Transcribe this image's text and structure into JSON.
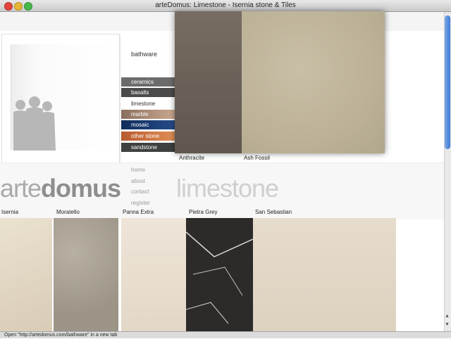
{
  "window": {
    "title": "arteDomus: Limestone - Isernia stone & Tiles"
  },
  "header": {
    "bathware_link": "bathware"
  },
  "menu": {
    "items": [
      {
        "label": "ceramics",
        "color": "#6b6b6b"
      },
      {
        "label": "basalts",
        "color": "#4b4b4b"
      },
      {
        "label": "limestone",
        "color": "#ffffff"
      },
      {
        "label": "marble",
        "color": "#b99a85"
      },
      {
        "label": "mosaic",
        "color": "#1b3b6e"
      },
      {
        "label": "other stone",
        "color": "#d07a45"
      },
      {
        "label": "sandstone",
        "color": "#3f4040"
      }
    ]
  },
  "nav": {
    "home": "home",
    "about": "about",
    "contact": "contact",
    "register": "register"
  },
  "branding": {
    "logo_light": "arte",
    "logo_bold": "domus",
    "page_heading": "limestone"
  },
  "popup": {
    "items": [
      {
        "label": "Anthracite",
        "color": "#6a6158"
      },
      {
        "label": "Ash Fossil",
        "color": "#bdb298"
      }
    ]
  },
  "swatches": [
    {
      "label": "Isernia",
      "color": "#e2d7c4"
    },
    {
      "label": "Moratello",
      "color": "#a49d90"
    },
    {
      "label": "Panna Extra",
      "color": "#e9ded0"
    },
    {
      "label": "Pietra Grey",
      "color": "#2d2b2a"
    },
    {
      "label": "San Sebastian",
      "color": "#e3d8c7"
    }
  ],
  "status": {
    "text": "Open \"http://artedomus.com/bathware\" in a new tab"
  },
  "scrollbar": {
    "up_arrow": "▲",
    "down_arrow": "▼"
  }
}
